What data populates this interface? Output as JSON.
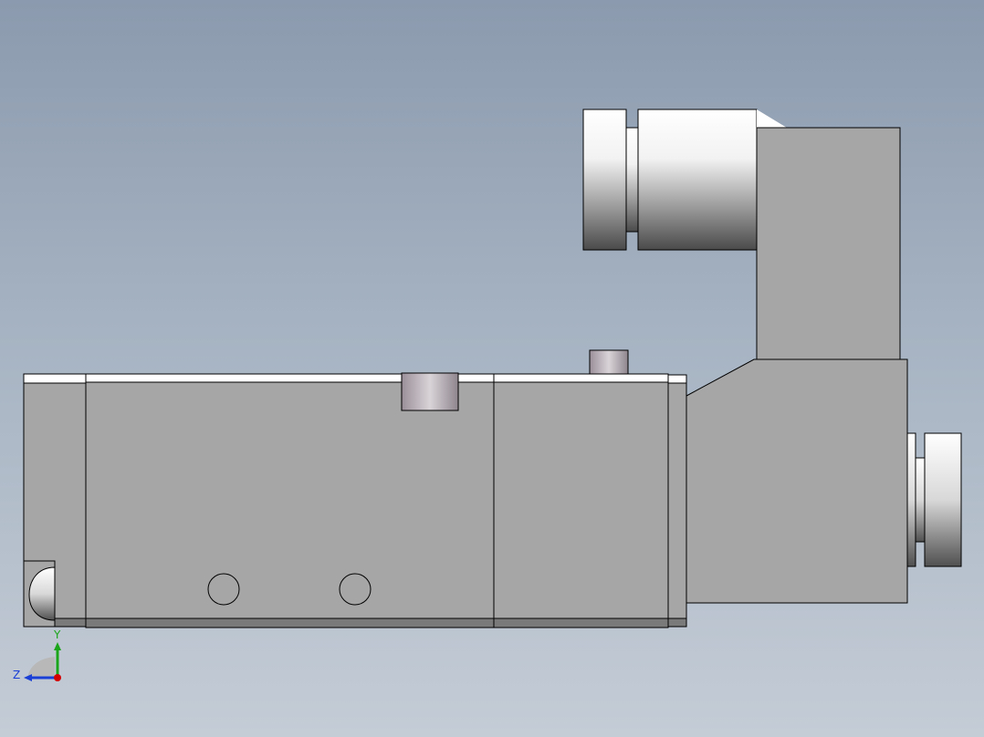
{
  "viewport": {
    "background_top": "#8b9aae",
    "background_bottom": "#c4ccd6"
  },
  "model": {
    "body_color": "#a6a6a6",
    "edge_color": "#000000",
    "highlight_color": "#ffffff"
  },
  "triad": {
    "y_label": "Y",
    "z_label": "Z",
    "y_color": "#1aa51a",
    "z_color": "#1a3fd6",
    "x_color": "#d40000"
  }
}
